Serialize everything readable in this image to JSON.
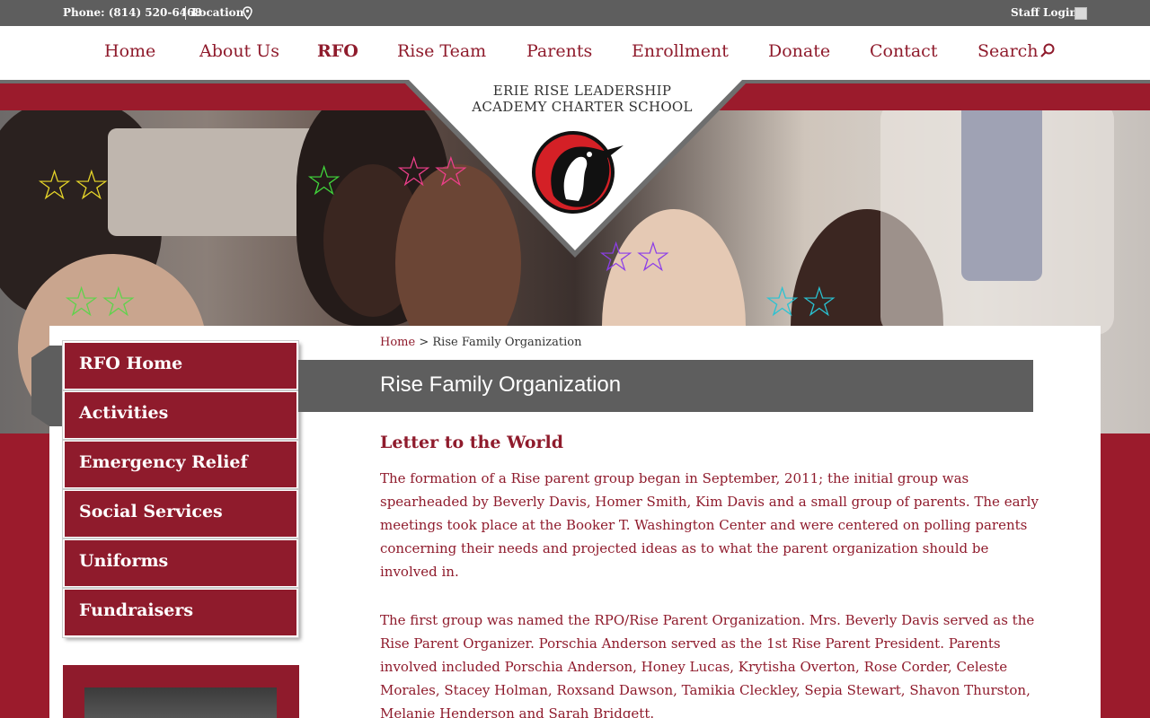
{
  "topbar": {
    "phone": "Phone: (814) 520-6468",
    "location": "Location",
    "staff_login": "Staff Login"
  },
  "nav": {
    "items": [
      "Home",
      "About Us",
      "RFO",
      "Rise Team",
      "Parents",
      "Enrollment",
      "Donate",
      "Contact",
      "Search"
    ],
    "active": "RFO"
  },
  "logo": {
    "line1": "ERIE RISE LEADERSHIP",
    "line2": "ACADEMY CHARTER SCHOOL"
  },
  "sidebar": {
    "items": [
      {
        "label": "RFO Home"
      },
      {
        "label": "Activities"
      },
      {
        "label": "Emergency Relief"
      },
      {
        "label": "Social Services"
      },
      {
        "label": "Uniforms"
      },
      {
        "label": "Fundraisers"
      }
    ]
  },
  "breadcrumb": {
    "home": "Home",
    "separator": ">",
    "current": "Rise Family Organization"
  },
  "page": {
    "title": "Rise Family Organization",
    "subheading": "Letter to the World",
    "paragraphs": [
      "The formation of a Rise parent group began in September, 2011; the initial group was spearheaded by Beverly Davis, Homer Smith, Kim Davis and a small group of parents. The early meetings took place at the Booker T. Washington Center and were centered on polling parents concerning their needs and projected ideas as to what the parent organization should be involved in.",
      "The first group was named the RPO/Rise Parent Organization. Mrs. Beverly Davis served as the Rise Parent Organizer. Porschia Anderson served as the 1st Rise Parent President. Parents involved included Porschia Anderson, Honey Lucas, Krytisha Overton, Rose Corder, Celeste Morales, Stacey Holman, Roxsand Dawson, Tamikia Cleckley, Sepia Stewart, Shavon Thurston, Melanie Henderson and Sarah Bridgett."
    ]
  },
  "colors": {
    "brand_red": "#8f1b2c",
    "gray": "#5e5e5e"
  }
}
